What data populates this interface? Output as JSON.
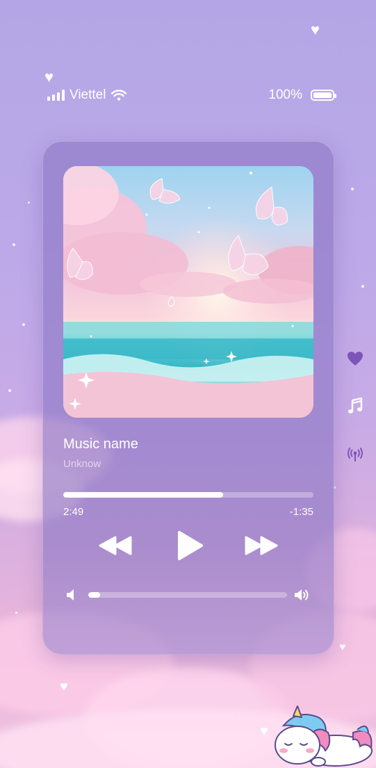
{
  "status_bar": {
    "carrier": "Viettel",
    "battery_percent": "100%",
    "battery_level": 1.0
  },
  "player": {
    "album_art_icon": "album-artwork-ocean-butterflies",
    "track_title": "Music name",
    "track_artist": "Unknow",
    "progress_fraction": 0.64,
    "time_elapsed": "2:49",
    "time_remaining": "-1:35",
    "controls": {
      "rewind_icon": "rewind-icon",
      "play_icon": "play-icon",
      "fast_forward_icon": "fast-forward-icon"
    },
    "volume": {
      "level_fraction": 0.06,
      "low_icon": "volume-low-icon",
      "high_icon": "volume-high-icon"
    }
  },
  "side_actions": [
    {
      "icon": "heart-icon",
      "name": "favorite"
    },
    {
      "icon": "music-note-icon",
      "name": "music"
    },
    {
      "icon": "broadcast-icon",
      "name": "broadcast"
    }
  ],
  "theme": {
    "accent": "#ffffff",
    "card_color": "#8b76c4",
    "background_top": "#b4a6e6",
    "background_bottom": "#f1c3e1"
  }
}
